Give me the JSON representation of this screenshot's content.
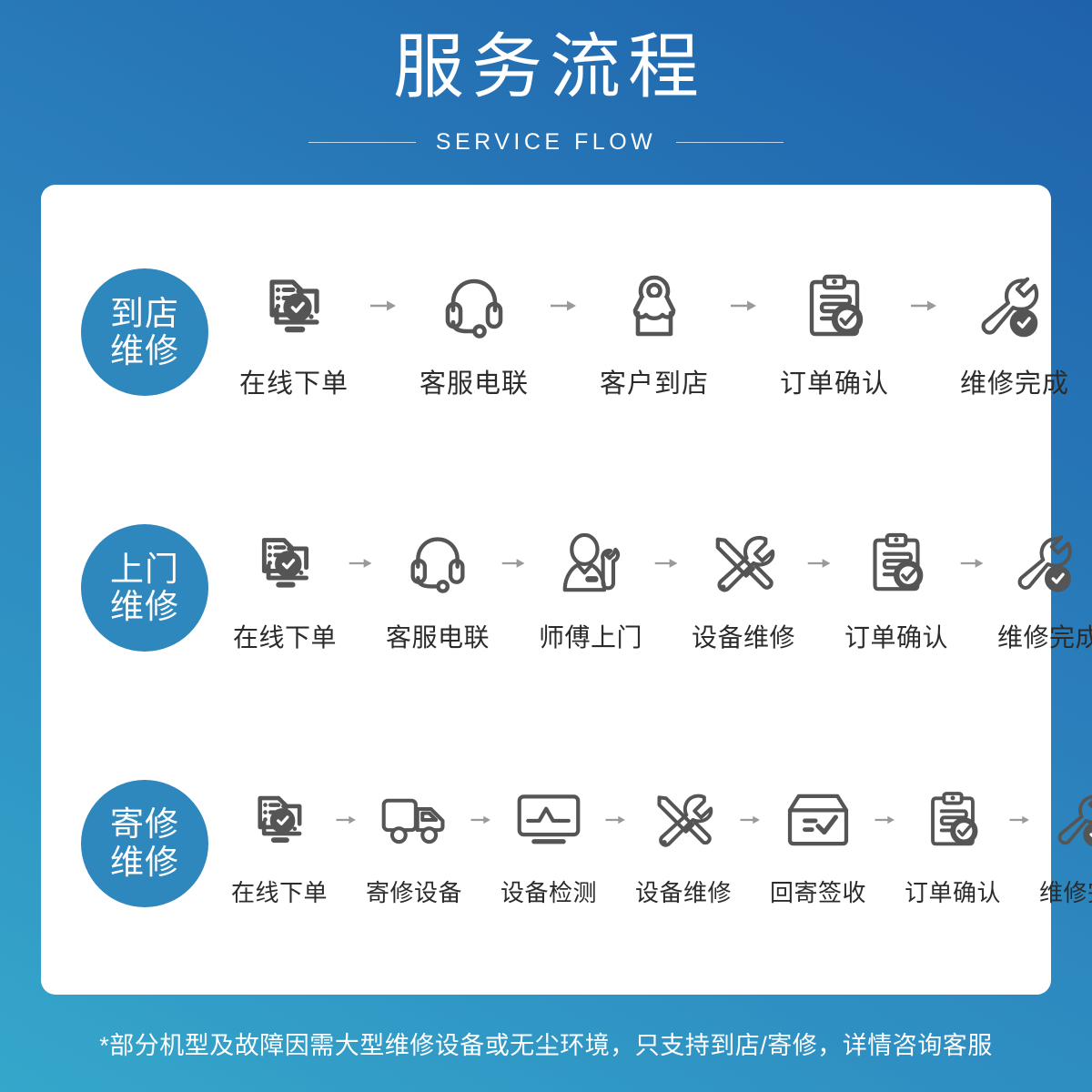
{
  "header": {
    "title": "服务流程",
    "subtitle": "SERVICE FLOW"
  },
  "colors": {
    "bg_gradient_from": "#35a7cb",
    "bg_gradient_to": "#1f62ac",
    "badge": "#2e87bd",
    "card": "#ffffff",
    "icon": "#555555",
    "arrow": "#9a9a9a",
    "label": "#2b2b2b"
  },
  "rows": [
    {
      "badge_line1": "到店",
      "badge_line2": "维修",
      "steps": [
        {
          "label": "在线下单",
          "icon": "online-order-icon"
        },
        {
          "label": "客服电联",
          "icon": "headset-icon"
        },
        {
          "label": "客户到店",
          "icon": "store-location-icon"
        },
        {
          "label": "订单确认",
          "icon": "clipboard-check-icon"
        },
        {
          "label": "维修完成",
          "icon": "wrench-check-icon"
        }
      ]
    },
    {
      "badge_line1": "上门",
      "badge_line2": "维修",
      "steps": [
        {
          "label": "在线下单",
          "icon": "online-order-icon"
        },
        {
          "label": "客服电联",
          "icon": "headset-icon"
        },
        {
          "label": "师傅上门",
          "icon": "technician-icon"
        },
        {
          "label": "设备维修",
          "icon": "tools-icon"
        },
        {
          "label": "订单确认",
          "icon": "clipboard-check-icon"
        },
        {
          "label": "维修完成",
          "icon": "wrench-check-icon"
        }
      ]
    },
    {
      "badge_line1": "寄修",
      "badge_line2": "维修",
      "steps": [
        {
          "label": "在线下单",
          "icon": "online-order-icon"
        },
        {
          "label": "寄修设备",
          "icon": "truck-icon"
        },
        {
          "label": "设备检测",
          "icon": "monitor-diagnostic-icon"
        },
        {
          "label": "设备维修",
          "icon": "tools-icon"
        },
        {
          "label": "回寄签收",
          "icon": "box-check-icon"
        },
        {
          "label": "订单确认",
          "icon": "clipboard-check-icon"
        },
        {
          "label": "维修完成",
          "icon": "wrench-check-icon"
        }
      ]
    }
  ],
  "footer": {
    "note": "*部分机型及故障因需大型维修设备或无尘环境，只支持到店/寄修，详情咨询客服"
  }
}
